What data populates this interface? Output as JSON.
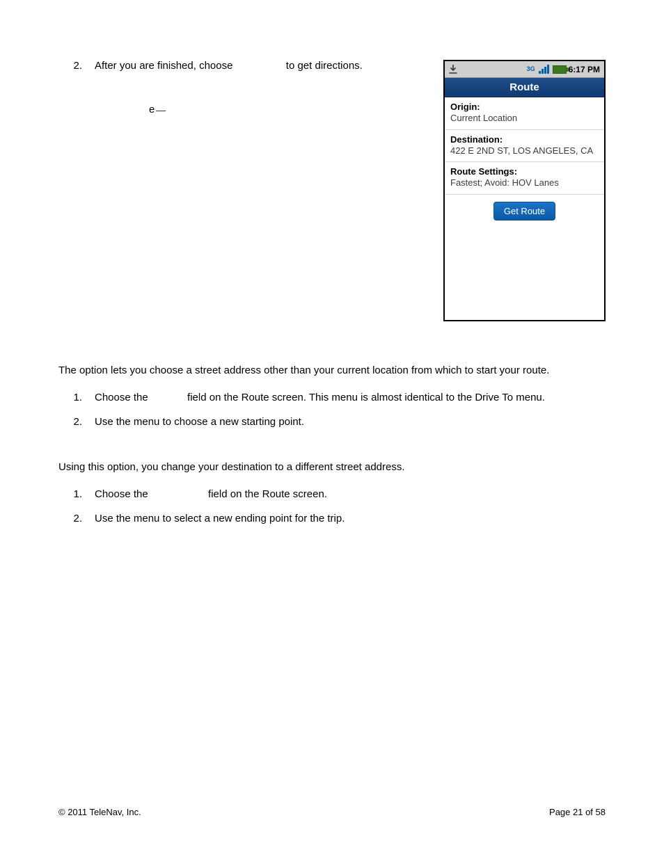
{
  "step2": {
    "num": "2.",
    "text_a": "After you are finished, choose ",
    "text_b": " to get directions."
  },
  "orphan_char": "e",
  "phone": {
    "time": "6:17 PM",
    "title": "Route",
    "origin_label": "Origin:",
    "origin_value": "Current Location",
    "dest_label": "Destination:",
    "dest_value": "422 E 2ND ST, LOS ANGELES, CA",
    "settings_label": "Route Settings:",
    "settings_value": "Fastest; Avoid: HOV Lanes",
    "button": "Get Route",
    "three_g": "3G"
  },
  "origin_section": {
    "intro": "The option lets you choose a street address other than your current location from which to start your route.",
    "items": [
      {
        "num": "1.",
        "a": "Choose the ",
        "b": " field on the Route screen. This menu is almost identical to the Drive To menu."
      },
      {
        "num": "2.",
        "a": "Use the menu to choose a new starting point.",
        "b": ""
      }
    ]
  },
  "dest_section": {
    "intro": "Using this option, you change your destination to a different street address.",
    "items": [
      {
        "num": "1.",
        "a": "Choose the ",
        "b": " field on the Route screen."
      },
      {
        "num": "2.",
        "a": "Use the menu to select a new ending point for the trip.",
        "b": ""
      }
    ]
  },
  "footer": {
    "left": "© 2011 TeleNav, Inc.",
    "right": "Page 21 of 58"
  }
}
